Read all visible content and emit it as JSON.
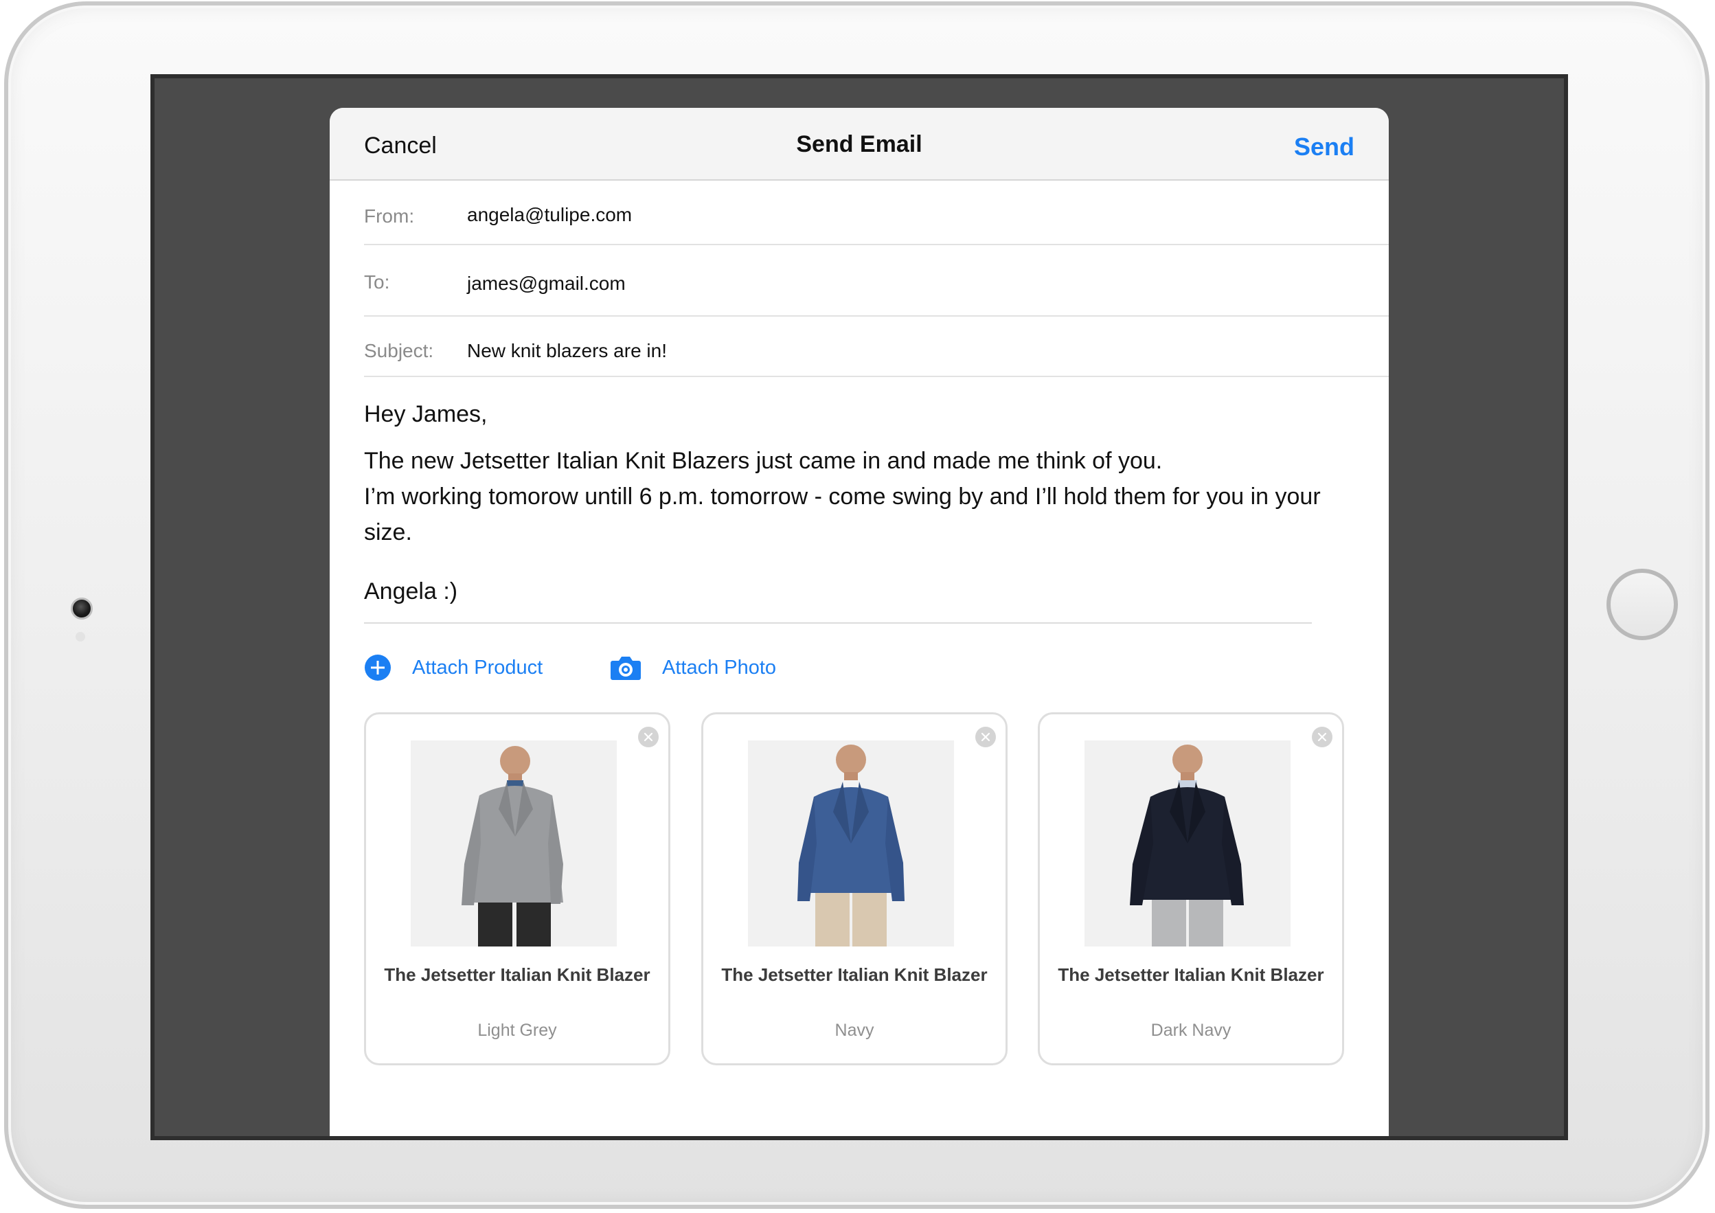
{
  "navbar": {
    "cancel_label": "Cancel",
    "title": "Send Email",
    "send_label": "Send",
    "accent_color": "#1b7ff3"
  },
  "fields": {
    "from": {
      "label": "From:",
      "value": "angela@tulipe.com"
    },
    "to": {
      "label": "To:",
      "value": "james@gmail.com"
    },
    "subject": {
      "label": "Subject:",
      "value": "New knit blazers are in!"
    }
  },
  "message": {
    "greeting": "Hey James,",
    "line1": "The new Jetsetter Italian Knit Blazers just came in and made me think of you.",
    "line2": "I’m working tomorow untill 6 p.m. tomorrow - come swing by and I’ll hold them for you in your size.",
    "signature": "Angela :)"
  },
  "attachments": {
    "product_label": "Attach Product",
    "photo_label": "Attach Photo",
    "product_icon": "plus-circle-icon",
    "photo_icon": "camera-icon"
  },
  "products": [
    {
      "name": "The Jetsetter Italian Knit Blazer",
      "color": "Light Grey",
      "blazer_hex": "#9a9c9f",
      "pants_hex": "#2a2a2a",
      "shirt_hex": "#3b5d8a"
    },
    {
      "name": "The Jetsetter Italian Knit Blazer",
      "color": "Navy",
      "blazer_hex": "#3d5f97",
      "pants_hex": "#d9c8b0",
      "shirt_hex": "#f4f4f4"
    },
    {
      "name": "The Jetsetter Italian Knit Blazer",
      "color": "Dark Navy",
      "blazer_hex": "#1c2130",
      "pants_hex": "#b7b8ba",
      "shirt_hex": "#c9d3e2"
    }
  ]
}
